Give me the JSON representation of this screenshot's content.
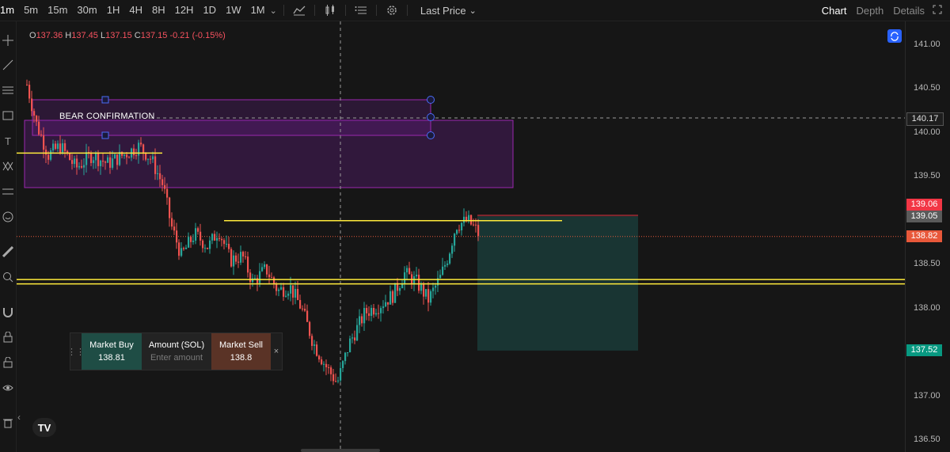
{
  "toolbar": {
    "timeframes": [
      "1m",
      "5m",
      "15m",
      "30m",
      "1H",
      "4H",
      "8H",
      "12H",
      "1D",
      "1W",
      "1M"
    ],
    "price_mode": "Last Price"
  },
  "tabs": {
    "chart": "Chart",
    "depth": "Depth",
    "details": "Details"
  },
  "legend": {
    "o_label": "O",
    "o": "137.36",
    "h_label": "H",
    "h": "137.45",
    "l_label": "L",
    "l": "137.15",
    "c_label": "C",
    "c": "137.15",
    "change": "-0.21 (-0.15%)"
  },
  "annotation": {
    "bear_label": "BEAR CONFIRMATION"
  },
  "price_axis": {
    "ticks": [
      "141.00",
      "140.50",
      "140.00",
      "139.50",
      "139.00",
      "138.50",
      "138.00",
      "137.50",
      "137.00",
      "136.50"
    ],
    "crosshair_price": "140.17",
    "stop_price": "139.06",
    "entry_price": "139.05",
    "last_price": "138.82",
    "target_price": "137.52"
  },
  "trade_panel": {
    "buy_label": "Market Buy",
    "buy_price": "138.81",
    "amount_label": "Amount (SOL)",
    "amount_placeholder": "Enter amount",
    "sell_label": "Market Sell",
    "sell_price": "138.8"
  },
  "colors": {
    "up": "#26a69a",
    "down": "#ef5350",
    "zone": "#7b1fa2",
    "yellow": "#ffeb3b"
  }
}
